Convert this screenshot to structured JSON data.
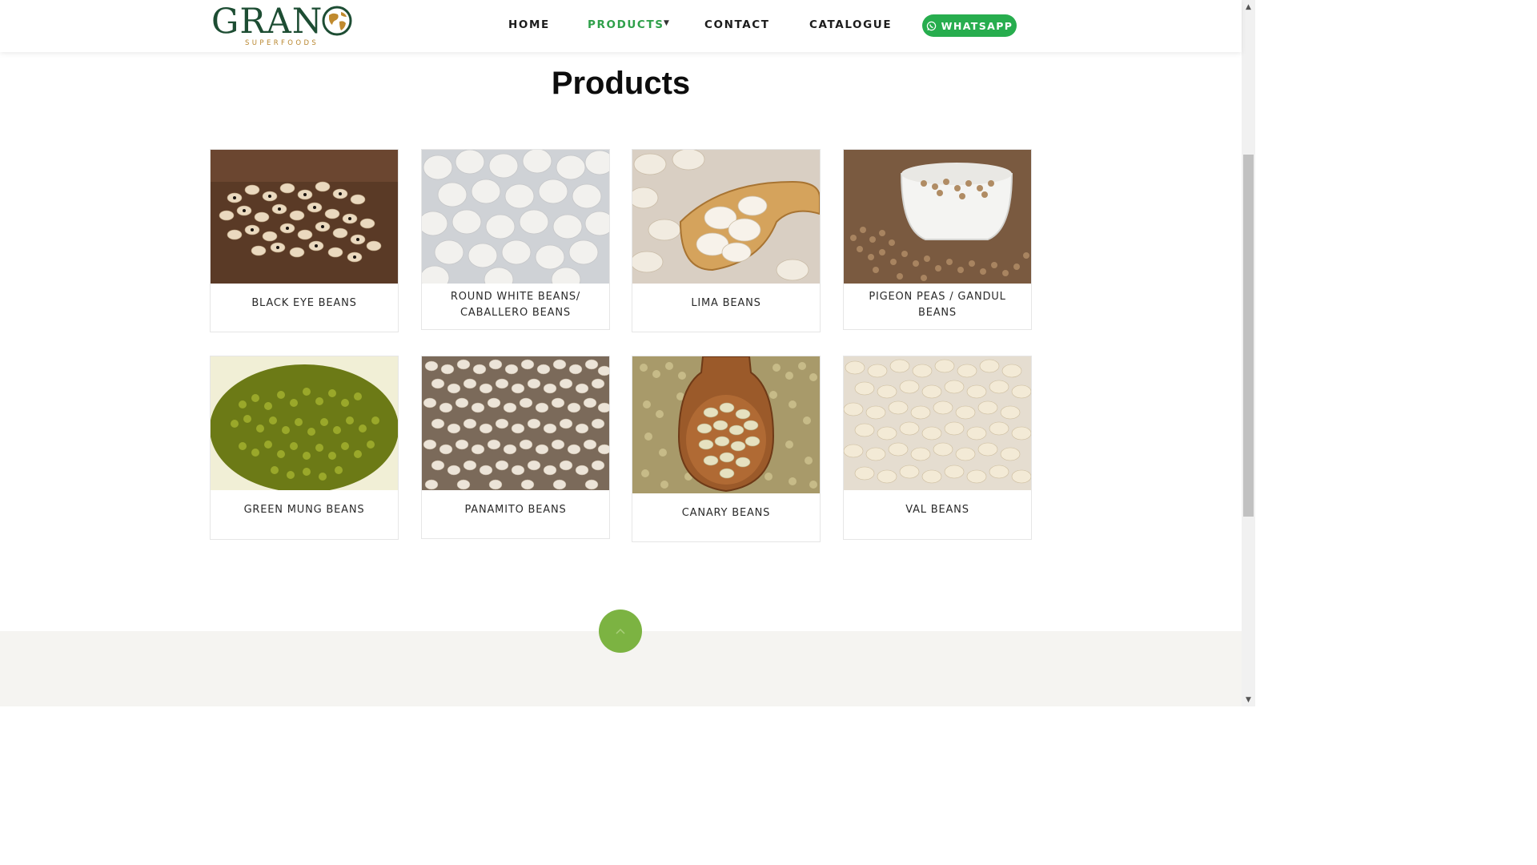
{
  "brand": {
    "name": "GRANO",
    "tagline": "SUPERFOODS",
    "primary_color": "#1d4d33",
    "accent_color": "#b8862e"
  },
  "nav": {
    "home": "HOME",
    "products": "PRODUCTS",
    "contact": "CONTACT",
    "catalogue": "CATALOGUE",
    "whatsapp": "WHATSAPP",
    "active": "PRODUCTS",
    "active_color": "#2fa04a",
    "whatsapp_color": "#27ad4e"
  },
  "page": {
    "title": "Products"
  },
  "products": [
    {
      "name": "BLACK EYE BEANS",
      "icon": "black-eye-beans-image"
    },
    {
      "name": "ROUND WHITE BEANS/ CABALLERO BEANS",
      "icon": "round-white-beans-image"
    },
    {
      "name": "LIMA BEANS",
      "icon": "lima-beans-image"
    },
    {
      "name": "PIGEON PEAS / GANDUL BEANS",
      "icon": "pigeon-peas-image"
    },
    {
      "name": "GREEN MUNG BEANS",
      "icon": "green-mung-beans-image"
    },
    {
      "name": "PANAMITO BEANS",
      "icon": "panamito-beans-image"
    },
    {
      "name": "CANARY BEANS",
      "icon": "canary-beans-image"
    },
    {
      "name": "VAL BEANS",
      "icon": "val-beans-image"
    }
  ],
  "scroll_top": {
    "icon": "chevron-up-icon",
    "color": "#7cb342"
  }
}
